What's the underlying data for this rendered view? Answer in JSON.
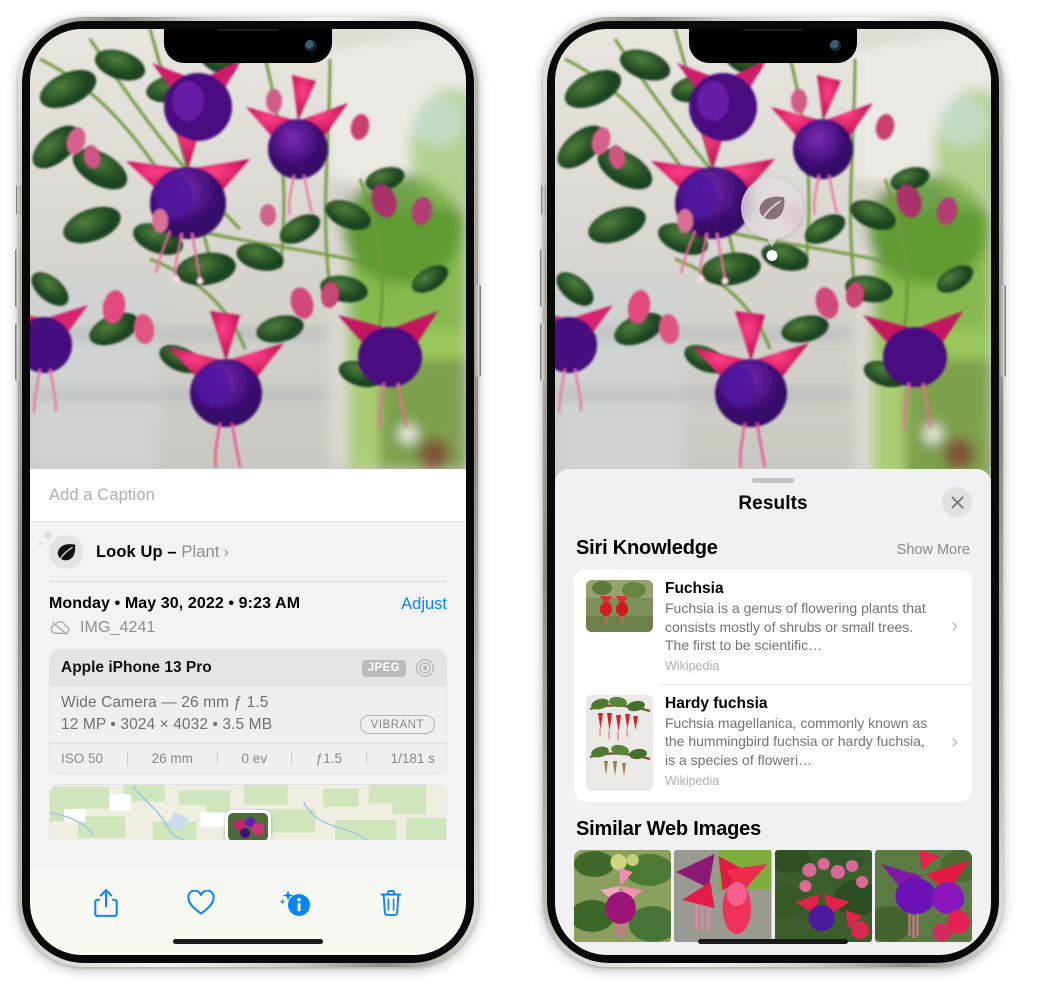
{
  "left_phone": {
    "name": "iPhone 13 Pro — Photos app, photo info sheet",
    "caption_field": {
      "placeholder": "Add a Caption",
      "value": ""
    },
    "look_up": {
      "label": "Look Up",
      "dash": " – ",
      "subject": "Plant",
      "chevron": "›",
      "icon": "leaf-icon"
    },
    "date_line": "Monday • May 30, 2022 • 9:23 AM",
    "adjust_label": "Adjust",
    "file_name": "IMG_4241",
    "cloud_icon": "cloud-slash-icon",
    "camera_card": {
      "model": "Apple iPhone 13 Pro",
      "format_badge": "JPEG",
      "lens_icon": "aperture-icon",
      "lens_line": "Wide Camera — 26 mm ƒ 1.5",
      "size_line": "12 MP • 3024 × 4032 • 3.5 MB",
      "style_badge": "VIBRANT",
      "exif": [
        "ISO 50",
        "26 mm",
        "0 ev",
        "ƒ1.5",
        "1/181 s"
      ]
    },
    "toolbar": [
      {
        "name": "share-button",
        "icon": "share-icon"
      },
      {
        "name": "favorite-button",
        "icon": "heart-icon"
      },
      {
        "name": "info-button",
        "icon": "info-sparkle-icon"
      },
      {
        "name": "delete-button",
        "icon": "trash-icon"
      }
    ]
  },
  "right_phone": {
    "name": "iPhone 13 Pro — Visual Look Up results sheet",
    "visual_lookup_badge": {
      "icon": "leaf-icon",
      "tooltip": ""
    },
    "sheet": {
      "title": "Results",
      "close_icon": "close-icon"
    },
    "siri_knowledge": {
      "title": "Siri Knowledge",
      "action": "Show More",
      "items": [
        {
          "title": "Fuchsia",
          "description": "Fuchsia is a genus of flowering plants that consists mostly of shrubs or small trees. The first to be scientific…",
          "source": "Wikipedia",
          "chevron": "›"
        },
        {
          "title": "Hardy fuchsia",
          "description": "Fuchsia magellanica, commonly known as the hummingbird fuchsia or hardy fuchsia, is a species of floweri…",
          "source": "Wikipedia",
          "chevron": "›"
        }
      ]
    },
    "similar_web_images": {
      "title": "Similar Web Images",
      "thumbnails": [
        "fuchsia-pink-white-flower",
        "fuchsia-red-closeup",
        "fuchsia-bush-buds",
        "fuchsia-purple-red-cluster"
      ]
    }
  },
  "colors": {
    "accent_blue": "#0a84ff",
    "sheet_bg": "#f1f1f4",
    "info_bg": "#f3f3f4",
    "card_bg": "#ffffff",
    "secondary_text": "#8e8e93",
    "toolbar_bg": "#f8f9f3"
  }
}
